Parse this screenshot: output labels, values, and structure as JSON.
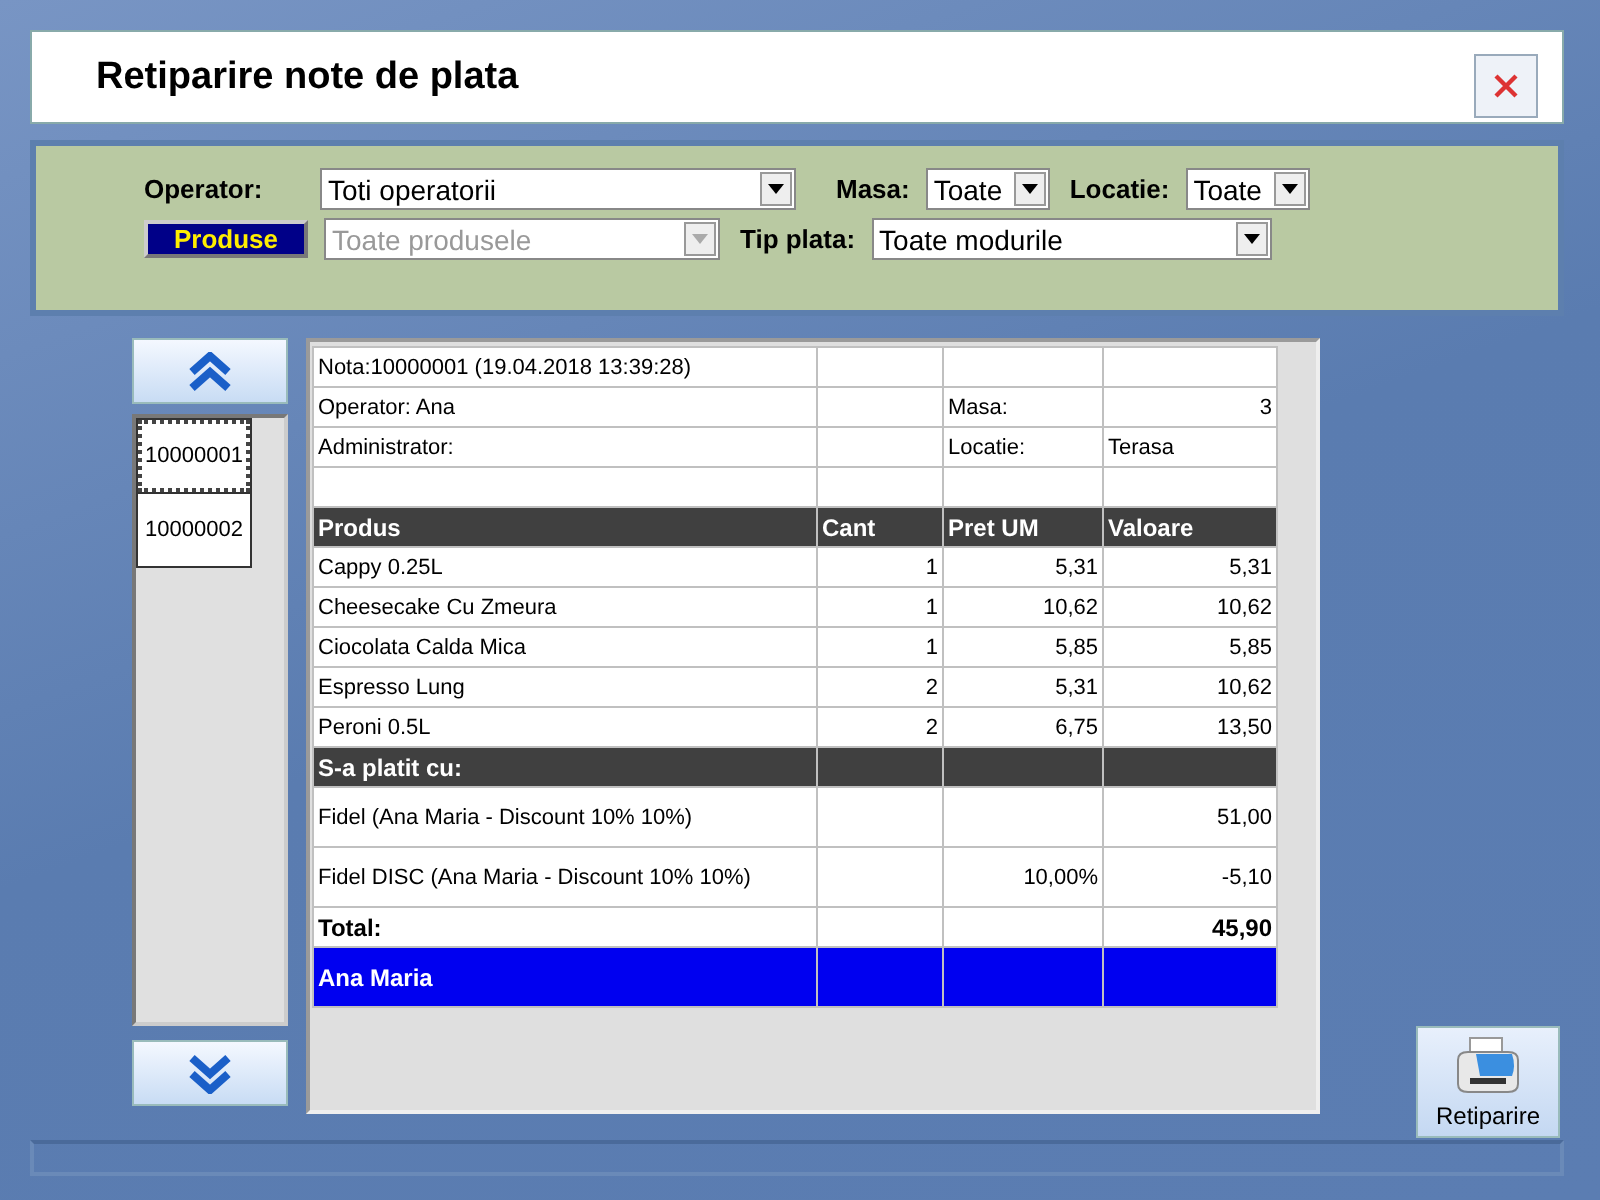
{
  "window": {
    "title": "Retiparire note de plata"
  },
  "filters": {
    "operator": {
      "label": "Operator:",
      "value": "Toti operatorii",
      "disabled": false
    },
    "produse_button": "Produse",
    "produse": {
      "value": "Toate produsele",
      "disabled": true
    },
    "masa": {
      "label": "Masa:",
      "value": "Toate",
      "disabled": false
    },
    "locatie": {
      "label": "Locatie:",
      "value": "Toate",
      "disabled": false
    },
    "tip_plata": {
      "label": "Tip plata:",
      "value": "Toate modurile",
      "disabled": false
    }
  },
  "notes": [
    {
      "label": "10000001",
      "selected": true
    },
    {
      "label": "10000002",
      "selected": false
    }
  ],
  "table": {
    "rows": [
      {
        "kind": "info",
        "text": "Nota:10000001 (19.04.2018 13:39:28)"
      },
      {
        "kind": "info",
        "text": "Operator: Ana",
        "field": "Masa:",
        "value": "3"
      },
      {
        "kind": "info",
        "text": "Administrator:",
        "field": "Locatie:",
        "value": "Terasa"
      },
      {
        "kind": "info"
      },
      {
        "kind": "header",
        "columns": [
          "Produs",
          "Cant",
          "Pret UM",
          "Valoare"
        ]
      },
      {
        "kind": "item",
        "produs": "Cappy 0.25L",
        "cant": "1",
        "pret_um": "5,31",
        "valoare": "5,31"
      },
      {
        "kind": "item",
        "produs": "Cheesecake Cu Zmeura",
        "cant": "1",
        "pret_um": "10,62",
        "valoare": "10,62"
      },
      {
        "kind": "item",
        "produs": "Ciocolata Calda Mica",
        "cant": "1",
        "pret_um": "5,85",
        "valoare": "5,85"
      },
      {
        "kind": "item",
        "produs": "Espresso Lung",
        "cant": "2",
        "pret_um": "5,31",
        "valoare": "10,62"
      },
      {
        "kind": "item",
        "produs": "Peroni 0.5L",
        "cant": "2",
        "pret_um": "6,75",
        "valoare": "13,50"
      },
      {
        "kind": "section",
        "text": "S-a platit cu:"
      },
      {
        "kind": "payment",
        "text": "Fidel (Ana Maria - Discount 10% 10%)",
        "valoare": "51,00"
      },
      {
        "kind": "payment",
        "text": "Fidel DISC (Ana Maria - Discount 10% 10%)",
        "pret_um": "10,00%",
        "valoare": "-5,10"
      },
      {
        "kind": "total",
        "text": "Total:",
        "valoare": "45,90"
      },
      {
        "kind": "client",
        "text": "Ana Maria"
      }
    ]
  },
  "reprint_button": "Retiparire"
}
